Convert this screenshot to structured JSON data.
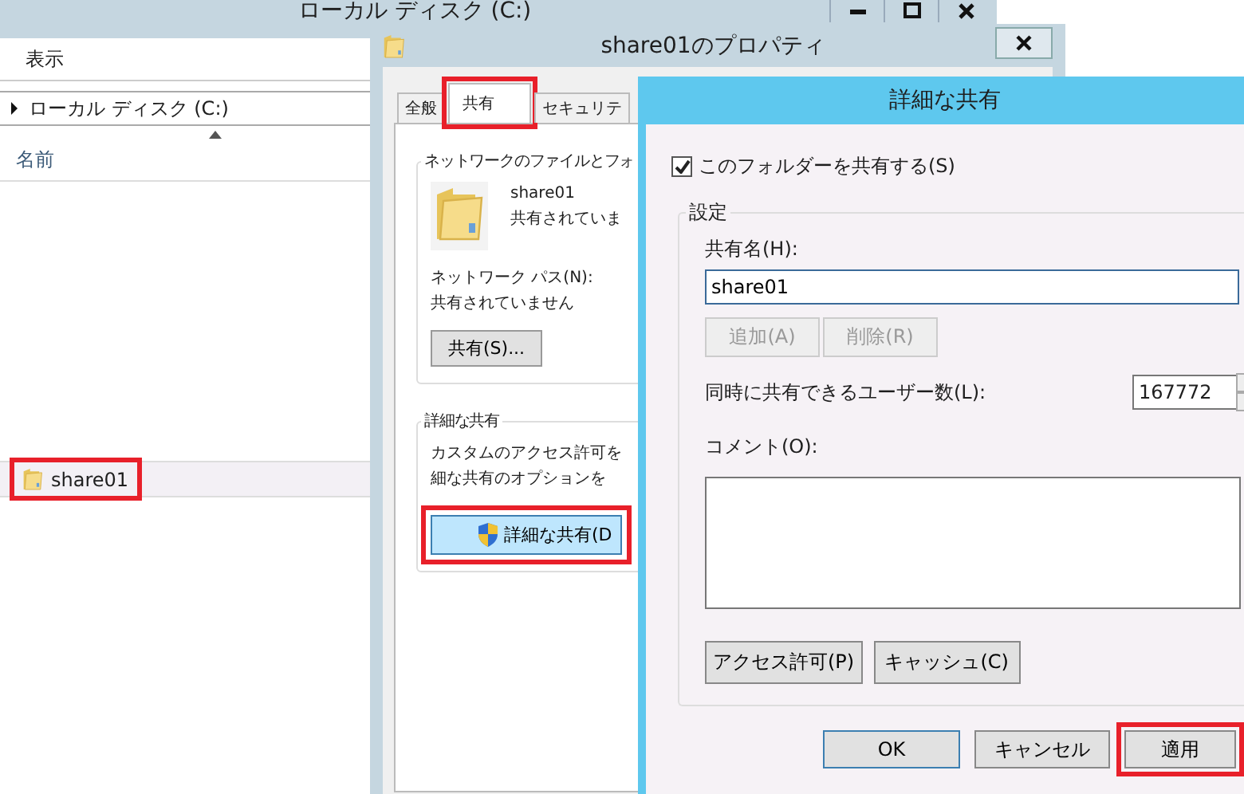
{
  "explorer": {
    "title": "ローカル ディスク (C:)",
    "ribbon_tab": "表示",
    "address": "ローカル ディスク (C:)",
    "column": "名前",
    "files": [
      {
        "name": "share01",
        "selected": true,
        "highlighted": true
      }
    ]
  },
  "properties": {
    "title": "share01のプロパティ",
    "tabs": [
      {
        "label": "全般",
        "selected": false,
        "highlighted": false
      },
      {
        "label": "共有",
        "selected": true,
        "highlighted": true
      },
      {
        "label": "セキュリテ",
        "selected": false,
        "highlighted": false
      }
    ],
    "network_group": {
      "title": "ネットワークのファイルとフォ",
      "folder_name": "share01",
      "folder_status": "共有されていま",
      "path_label": "ネットワーク パス(N):",
      "path_value": "共有されていません",
      "share_button": "共有(S)..."
    },
    "advanced_group": {
      "title": "詳細な共有",
      "description": [
        "カスタムのアクセス許可を",
        "細な共有のオプションを"
      ],
      "button": {
        "label": "詳細な共有(D",
        "highlighted": true
      }
    }
  },
  "advanced_dialog": {
    "title": "詳細な共有",
    "share_checkbox": {
      "label": "このフォルダーを共有する(S)",
      "checked": true
    },
    "settings": {
      "title": "設定",
      "share_name_label": "共有名(H):",
      "share_name": "share01",
      "add_button": {
        "label": "追加(A)",
        "disabled": true
      },
      "remove_button": {
        "label": "削除(R)",
        "disabled": true
      },
      "user_limit_label": "同時に共有できるユーザー数(L):",
      "user_limit": "167772",
      "comment_label": "コメント(O):",
      "permissions_button": "アクセス許可(P)",
      "caching_button": "キャッシュ(C)"
    },
    "buttons": [
      {
        "label": "OK",
        "default": true,
        "highlighted": false
      },
      {
        "label": "キャンセル",
        "default": false,
        "highlighted": false
      },
      {
        "label": "適用",
        "default": false,
        "highlighted": true
      }
    ]
  }
}
